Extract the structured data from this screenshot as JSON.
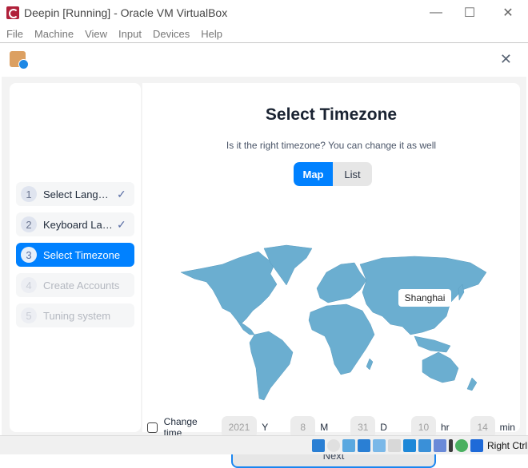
{
  "window": {
    "title": "Deepin [Running] - Oracle VM VirtualBox",
    "controls": {
      "minimize": "—",
      "maximize": "☐",
      "close": "✕"
    }
  },
  "menubar": {
    "items": [
      "File",
      "Machine",
      "View",
      "Input",
      "Devices",
      "Help"
    ]
  },
  "installer": {
    "close": "✕",
    "steps": [
      {
        "num": "1",
        "label": "Select Language",
        "state": "done",
        "check": "✓"
      },
      {
        "num": "2",
        "label": "Keyboard Layout",
        "state": "done",
        "check": "✓"
      },
      {
        "num": "3",
        "label": "Select Timezone",
        "state": "active"
      },
      {
        "num": "4",
        "label": "Create Accounts",
        "state": "disabled"
      },
      {
        "num": "5",
        "label": "Tuning system",
        "state": "disabled"
      }
    ],
    "title": "Select Timezone",
    "subtitle": "Is it the right timezone? You can change it as well",
    "view_toggle": {
      "map": "Map",
      "list": "List",
      "selected": "Map"
    },
    "map": {
      "selected_city": "Shanghai",
      "land_color": "#6baed0"
    },
    "change_time": {
      "label": "Change time",
      "checked": false,
      "year": "2021",
      "year_unit": "Y",
      "month": "8",
      "month_unit": "M",
      "day": "31",
      "day_unit": "D",
      "hour": "10",
      "hour_unit": "hr",
      "minute": "14",
      "minute_unit": "min"
    },
    "next_label": "Next"
  },
  "statusbar": {
    "icons": [
      "audio-icon",
      "optical-drive-icon",
      "audio-settings-icon",
      "network-icon",
      "usb-icon",
      "shared-folder-icon",
      "display-icon",
      "screen-capture-icon",
      "vbox-additions-icon",
      "cpu-activity-icon",
      "mouse-integration-icon",
      "keyboard-capture-icon"
    ],
    "host_key": "Right Ctrl"
  },
  "colors": {
    "accent": "#0081ff",
    "map_land": "#6baed0"
  }
}
